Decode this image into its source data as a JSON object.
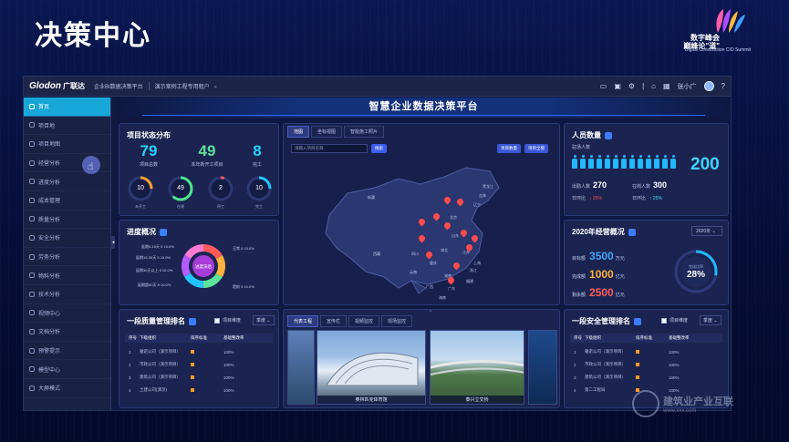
{
  "slide_title": "决策中心",
  "brand": {
    "line1": "数字峰会",
    "line2": "巅峰论\"道\"",
    "line3": "Digital Construction CIO Summit"
  },
  "topbar": {
    "logo": "Glodon",
    "logo_cn": "广联达",
    "system": "企业BI数据决策平台",
    "tenant": "演示案例工程专用租户",
    "user": "张小广"
  },
  "sidebar": {
    "items": [
      "首页",
      "项目地",
      "项目地图",
      "经营分析",
      "进度分析",
      "成本管理",
      "质量分析",
      "安全分析",
      "劳务分析",
      "物料分析",
      "技术分析",
      "视频中心",
      "文档分析",
      "预警提示",
      "模型中心",
      "大屏模式"
    ]
  },
  "dashboard": {
    "title": "智慧企业数据决策平台",
    "project_status": {
      "title": "项目状态分布",
      "stats": [
        {
          "value": "79",
          "label": "项目总数",
          "color": "#23d1ff"
        },
        {
          "value": "49",
          "label": "本年新开工项目",
          "color": "#5be39a"
        },
        {
          "value": "8",
          "label": "完工",
          "color": "#23d1ff"
        }
      ],
      "rings": [
        {
          "value": "10",
          "label": "未开工",
          "color": "#ff9d2a",
          "frac": 0.25
        },
        {
          "value": "49",
          "label": "在建",
          "color": "#4ee38f",
          "frac": 0.62
        },
        {
          "value": "2",
          "label": "停工",
          "color": "#ff5a5a",
          "frac": 0.05
        },
        {
          "value": "10",
          "label": "完工",
          "color": "#23c3ff",
          "frac": 0.25
        }
      ]
    },
    "progress": {
      "title": "进度概况",
      "center_label": "进度滞后",
      "legend": [
        "延期0-15天",
        "5  10.0%",
        "延期15-30天",
        "5  10.0%",
        "延期30天以上",
        "5  10.0%",
        "延期超60天",
        "5  10.0%",
        "正常",
        "5  10.0%",
        "提前",
        "5  10.0%"
      ]
    },
    "map": {
      "tabs": [
        "地图",
        "坐标视图",
        "智能施工照片"
      ],
      "search_placeholder": "请输入项目名称",
      "search_btn": "搜索",
      "btn_current": "项目数量",
      "btn_all": "项目全貌",
      "labels": [
        "黑龙江",
        "吉林",
        "辽宁",
        "新疆",
        "北京",
        "山东",
        "江苏",
        "上海",
        "西藏",
        "四川",
        "湖北",
        "重庆",
        "浙江",
        "云南",
        "广西",
        "湖南",
        "广东",
        "福建",
        "海南"
      ]
    },
    "people": {
      "title": "人员数量",
      "subtitle": "驻场人数",
      "total": "200",
      "attend_label": "出勤人数",
      "attend_value": "270",
      "onsite_label": "在岗人数",
      "onsite_value": "300",
      "ratio_label": "日环比",
      "ratio1": "↓ 25%",
      "ratio2": "日环比",
      "ratio3": "↑ 25%"
    },
    "ops": {
      "title": "2020年经营概况",
      "year": "2020年",
      "rows": [
        {
          "label": "目标额",
          "value": "3500",
          "unit": "万元"
        },
        {
          "label": "完成额",
          "value": "1000",
          "unit": "亿元"
        },
        {
          "label": "剩余额",
          "value": "2500",
          "unit": "亿元"
        }
      ],
      "gauge_label": "完成比率",
      "gauge_value": "28%",
      "gauge_frac": 0.28
    },
    "quality_rank": {
      "title": "一段质量管理排名",
      "toggle": "项目维度",
      "select": "季度",
      "headers": [
        "序号",
        "下级组织",
        "排序标准",
        "基础整改率"
      ],
      "rows": [
        {
          "no": "1",
          "org": "雅诺公司（演示项目）",
          "rate": "100%"
        },
        {
          "no": "2",
          "org": "市政公司（演示项目）",
          "rate": "100%"
        },
        {
          "no": "3",
          "org": "建筑公司（演示项目）",
          "rate": "100%"
        },
        {
          "no": "4",
          "org": "土建公司(演示)",
          "rate": "100%"
        }
      ]
    },
    "media": {
      "tabs": [
        "代表工程",
        "宣传栏",
        "视频监控",
        "现场监控"
      ],
      "captions": [
        "奥林匹克体育馆",
        "泰兴立交桥"
      ]
    },
    "safety_rank": {
      "title": "一段安全管理排名",
      "toggle": "项目维度",
      "select": "季度",
      "headers": [
        "序号",
        "下级组织",
        "排序标准",
        "基础整改率"
      ],
      "rows": [
        {
          "no": "1",
          "org": "雅诺公司（演示项目）",
          "rate": "100%"
        },
        {
          "no": "2",
          "org": "市政公司（演示项目）",
          "rate": "100%"
        },
        {
          "no": "3",
          "org": "建筑公司（演示项目）",
          "rate": "100%"
        },
        {
          "no": "4",
          "org": "第二工程局",
          "rate": "100%"
        }
      ]
    }
  },
  "watermark": {
    "title": "建筑业产业互联",
    "sub": "www.xxx.com"
  }
}
